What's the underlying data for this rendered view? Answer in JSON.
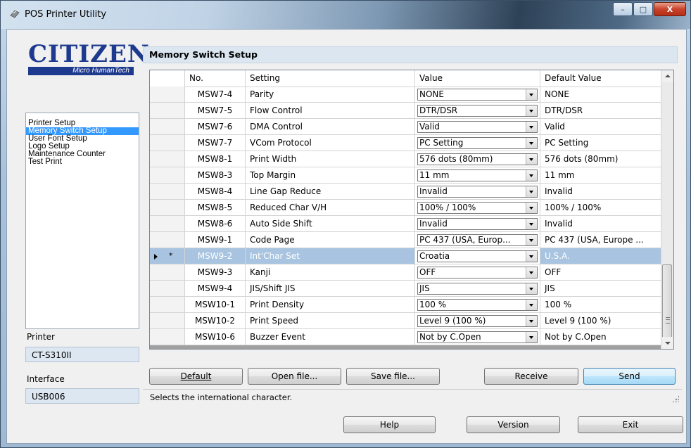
{
  "window": {
    "title": "POS Printer Utility",
    "minimize_glyph": "–",
    "maximize_glyph": "□",
    "close_glyph": "X"
  },
  "logo": {
    "brand": "CITIZEN",
    "sub": "Micro HumanTech"
  },
  "nav": {
    "items": [
      {
        "label": "Printer Setup",
        "selected": false
      },
      {
        "label": "Memory Switch Setup",
        "selected": true
      },
      {
        "label": "User Font Setup",
        "selected": false
      },
      {
        "label": "Logo Setup",
        "selected": false
      },
      {
        "label": "Maintenance Counter",
        "selected": false
      },
      {
        "label": "Test Print",
        "selected": false
      }
    ]
  },
  "printer": {
    "label": "Printer",
    "value": "CT-S310II"
  },
  "interface": {
    "label": "Interface",
    "value": "USB006"
  },
  "section_title": "Memory Switch Setup",
  "grid": {
    "columns": [
      "No.",
      "Setting",
      "Value",
      "Default Value"
    ],
    "current_marker": "*",
    "rows": [
      {
        "no": "MSW7-4",
        "setting": "Parity",
        "value": "NONE",
        "default": "NONE"
      },
      {
        "no": "MSW7-5",
        "setting": "Flow Control",
        "value": "DTR/DSR",
        "default": "DTR/DSR"
      },
      {
        "no": "MSW7-6",
        "setting": "DMA Control",
        "value": "Valid",
        "default": "Valid"
      },
      {
        "no": "MSW7-7",
        "setting": "VCom Protocol",
        "value": "PC Setting",
        "default": "PC Setting"
      },
      {
        "no": "MSW8-1",
        "setting": "Print Width",
        "value": "576 dots (80mm)",
        "default": "576 dots (80mm)"
      },
      {
        "no": "MSW8-3",
        "setting": "Top Margin",
        "value": "11 mm",
        "default": "11 mm"
      },
      {
        "no": "MSW8-4",
        "setting": "Line Gap Reduce",
        "value": "Invalid",
        "default": "Invalid"
      },
      {
        "no": "MSW8-5",
        "setting": "Reduced Char V/H",
        "value": "100% / 100%",
        "default": "100% / 100%"
      },
      {
        "no": "MSW8-6",
        "setting": "Auto Side Shift",
        "value": "Invalid",
        "default": "Invalid"
      },
      {
        "no": "MSW9-1",
        "setting": "Code Page",
        "value": "PC 437 (USA, Europ...",
        "default": "PC 437 (USA, Europe ..."
      },
      {
        "no": "MSW9-2",
        "setting": "Int'Char Set",
        "value": "Croatia",
        "default": "U.S.A.",
        "current": true
      },
      {
        "no": "MSW9-3",
        "setting": "Kanji",
        "value": "OFF",
        "default": "OFF"
      },
      {
        "no": "MSW9-4",
        "setting": "JIS/Shift JIS",
        "value": "JIS",
        "default": "JIS"
      },
      {
        "no": "MSW10-1",
        "setting": "Print Density",
        "value": "100 %",
        "default": "100 %"
      },
      {
        "no": "MSW10-2",
        "setting": "Print Speed",
        "value": "Level 9 (100 %)",
        "default": "Level 9 (100 %)"
      },
      {
        "no": "MSW10-6",
        "setting": "Buzzer Event",
        "value": "Not by C.Open",
        "default": "Not by C.Open"
      }
    ]
  },
  "buttons": {
    "default": "Default",
    "open_file": "Open file...",
    "save_file": "Save file...",
    "receive": "Receive",
    "send": "Send",
    "help": "Help",
    "version": "Version",
    "exit": "Exit"
  },
  "status": "Selects the international character.",
  "colors": {
    "selected_nav": "#3399ff",
    "current_row": "#a8c4e0",
    "brand": "#1d3a8e"
  }
}
